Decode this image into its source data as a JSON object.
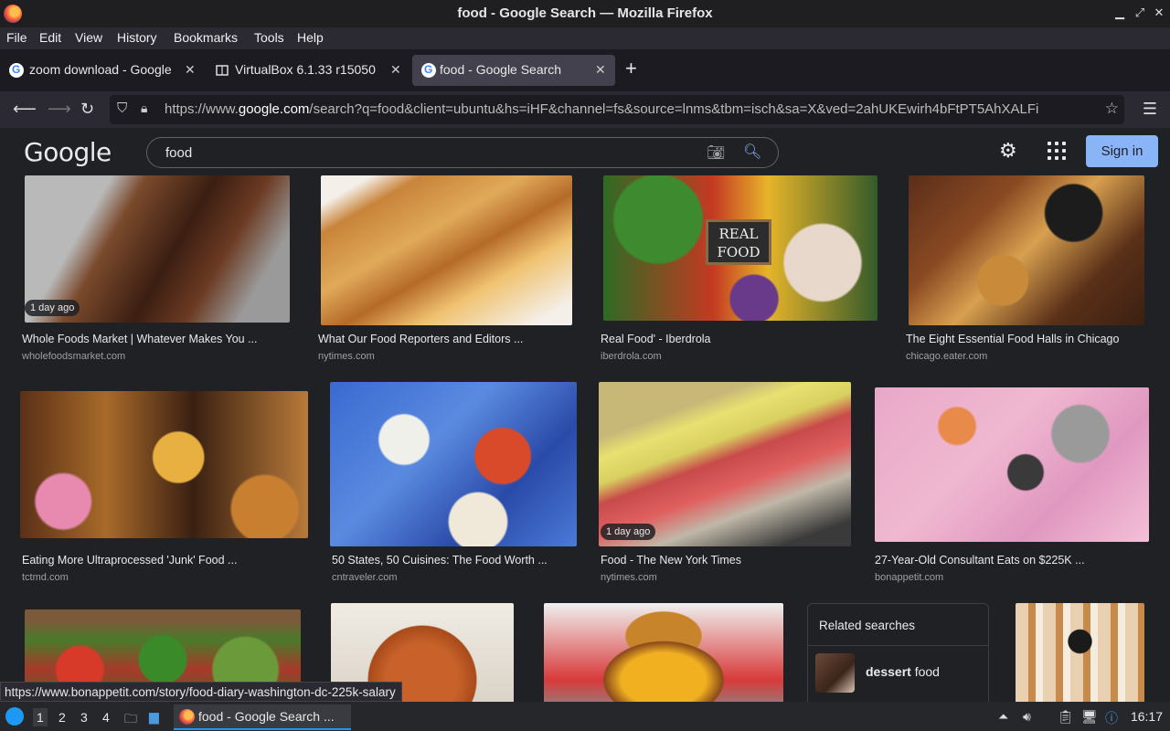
{
  "window": {
    "title": "food - Google Search — Mozilla Firefox"
  },
  "menu": [
    "File",
    "Edit",
    "View",
    "History",
    "Bookmarks",
    "Tools",
    "Help"
  ],
  "tabs": [
    {
      "label": "zoom download - Google",
      "active": false
    },
    {
      "label": "VirtualBox 6.1.33 r15050",
      "active": false
    },
    {
      "label": "food - Google Search",
      "active": true
    }
  ],
  "nav": {
    "url_prefix": "https://www.",
    "url_domain": "google.com",
    "url_rest": "/search?q=food&client=ubuntu&hs=iHF&channel=fs&source=lnms&tbm=isch&sa=X&ved=2ahUKEwirh4bFtPT5AhXALFi"
  },
  "google": {
    "logo": "Google",
    "query": "food",
    "signin": "Sign in"
  },
  "results": [
    {
      "caption": "Whole Foods Market | Whatever Makes You ...",
      "source": "wholefoodsmarket.com",
      "badge": "1 day ago"
    },
    {
      "caption": "What Our Food Reporters and Editors ...",
      "source": "nytimes.com",
      "badge": ""
    },
    {
      "caption": "Real Food' - Iberdrola",
      "source": "iberdrola.com",
      "badge": "",
      "img_text": "REAL FOOD"
    },
    {
      "caption": "The Eight Essential Food Halls in Chicago",
      "source": "chicago.eater.com",
      "badge": ""
    },
    {
      "caption": "Eating More Ultraprocessed 'Junk' Food ...",
      "source": "tctmd.com",
      "badge": ""
    },
    {
      "caption": "50 States, 50 Cuisines: The Food Worth ...",
      "source": "cntraveler.com",
      "badge": ""
    },
    {
      "caption": "Food - The New York Times",
      "source": "nytimes.com",
      "badge": "1 day ago"
    },
    {
      "caption": "27-Year-Old Consultant Eats on $225K ...",
      "source": "bonappetit.com",
      "badge": ""
    }
  ],
  "related": {
    "heading": "Related searches",
    "term_bold": "dessert",
    "term_rest": " food"
  },
  "status_url": "https://www.bonappetit.com/story/food-diary-washington-dc-225k-salary",
  "taskbar": {
    "workspaces": [
      "1",
      "2",
      "3",
      "4"
    ],
    "app_label": "food - Google Search ...",
    "clock": "16:17"
  }
}
